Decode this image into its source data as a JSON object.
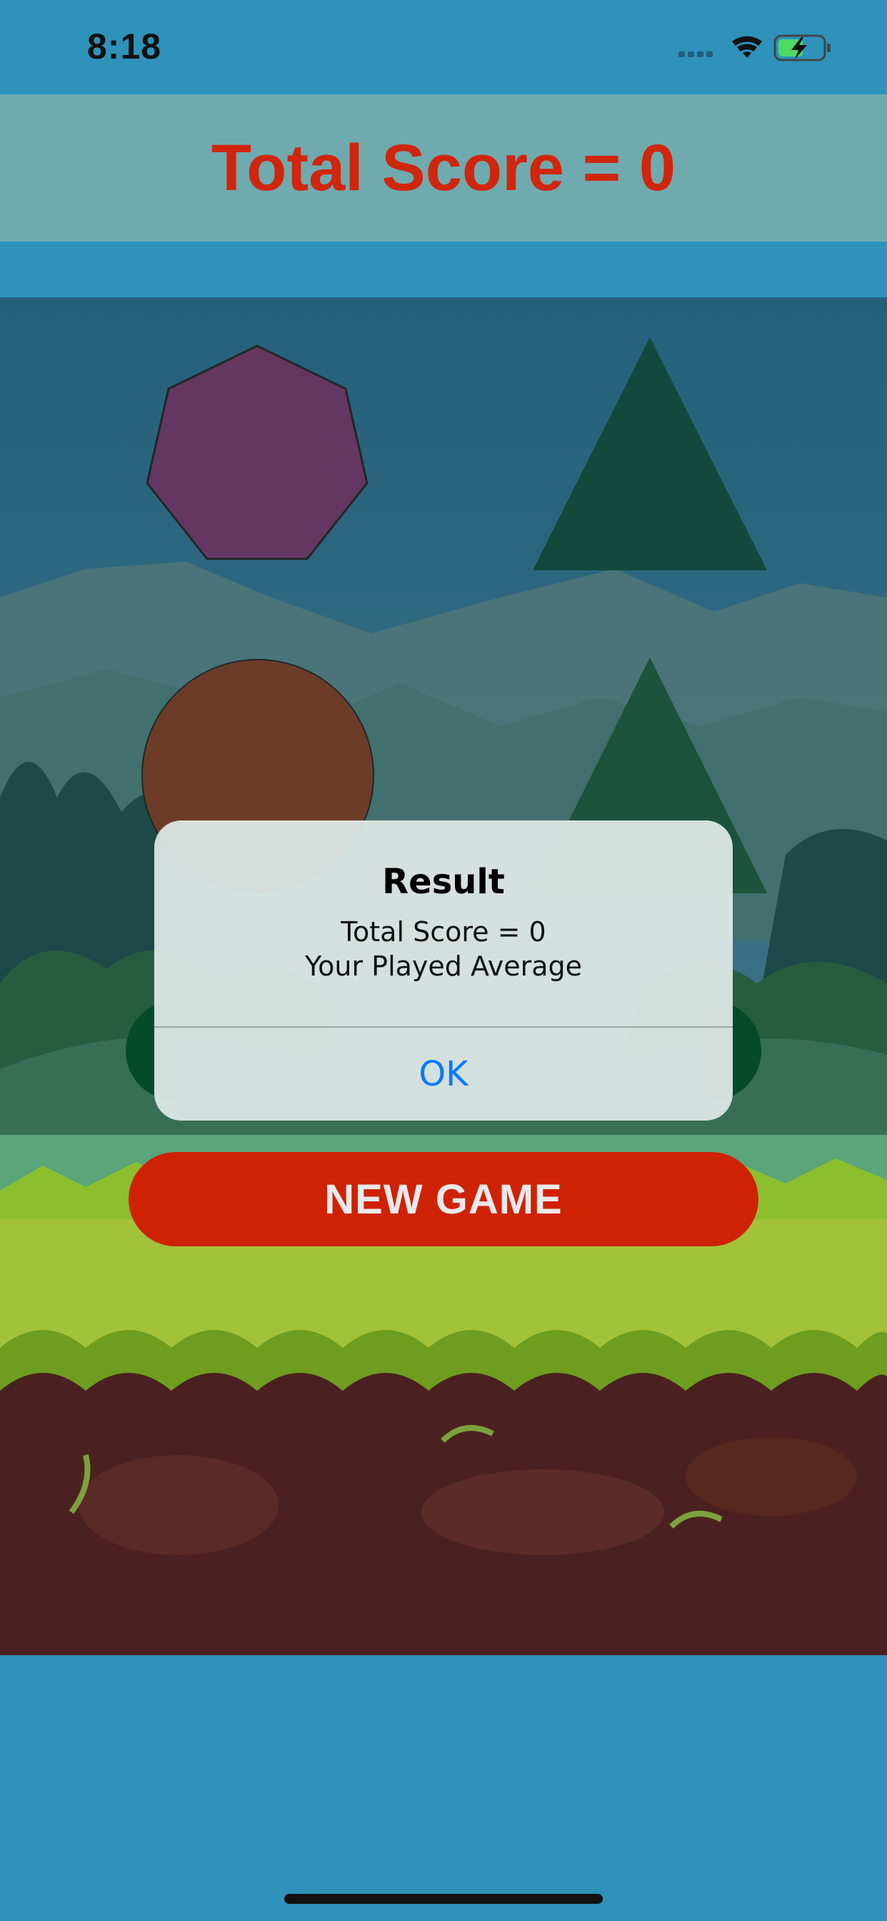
{
  "status_bar": {
    "time": "8:18"
  },
  "header": {
    "score_title": "Total Score = 0"
  },
  "game": {
    "new_game_label": "NEW GAME",
    "shapes": [
      "heptagon",
      "triangle",
      "circle",
      "triangle",
      "circle",
      "circle"
    ]
  },
  "alert": {
    "title": "Result",
    "message_line1": "Total Score = 0",
    "message_line2": "Your Played Average",
    "ok_label": "OK"
  },
  "colors": {
    "score_red": "#d0260d",
    "button_red": "#cf2205",
    "sky_blue": "#2f92bb",
    "banner_teal": "#6faaaf",
    "alert_blue": "#0a7aff"
  }
}
